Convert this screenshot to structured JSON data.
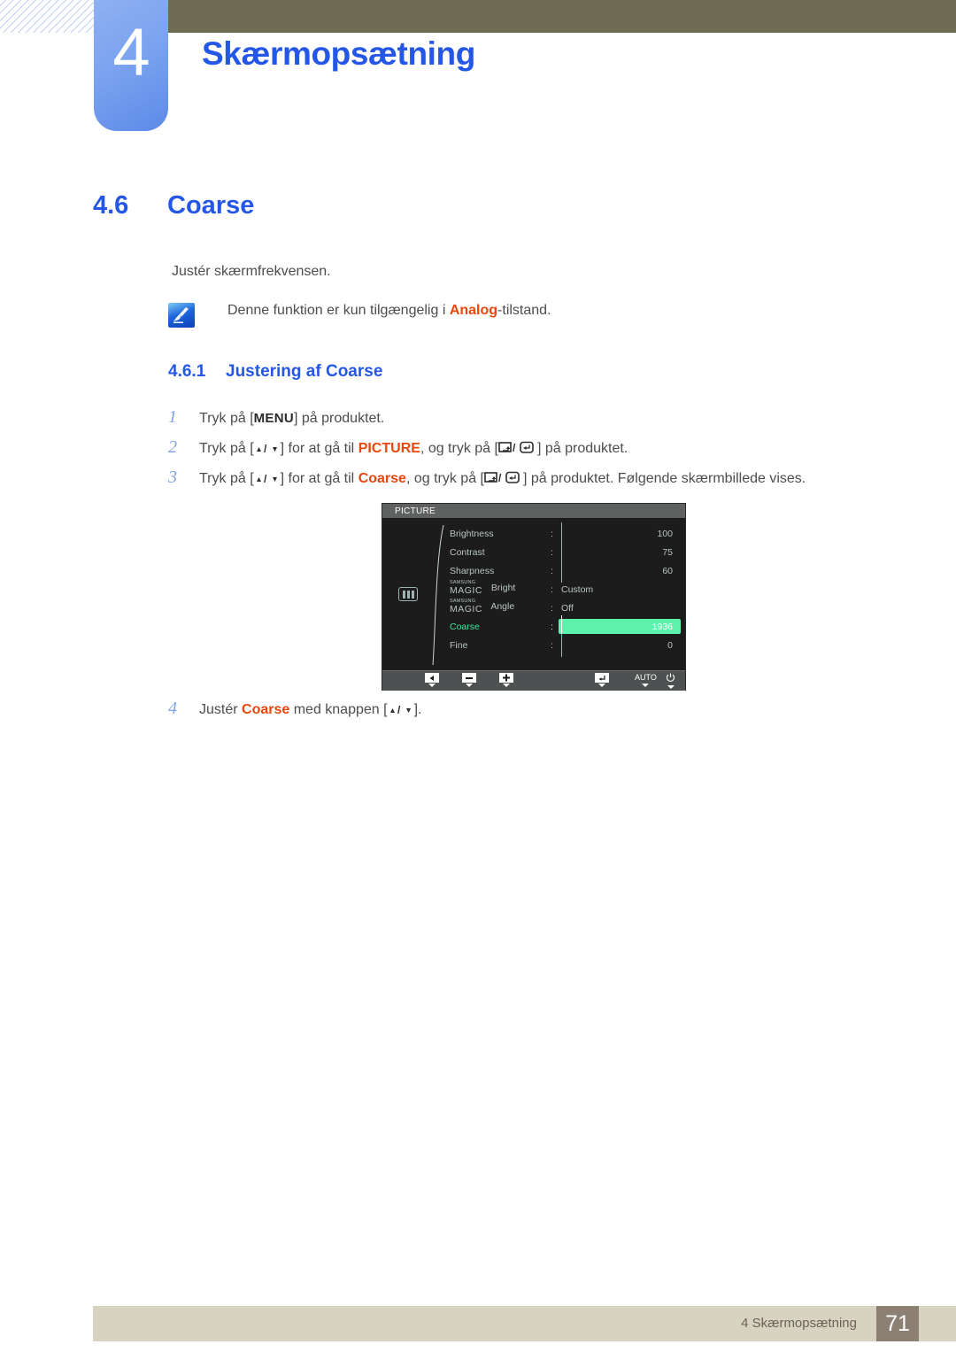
{
  "header": {
    "chapter_number": "4",
    "chapter_title": "Skærmopsætning"
  },
  "section": {
    "number": "4.6",
    "title": "Coarse",
    "intro": "Justér skærmfrekvensen."
  },
  "note": {
    "icon": "note-pencil-icon",
    "text_before": "Denne funktion er kun tilgængelig i ",
    "highlight": "Analog",
    "text_after": "-tilstand."
  },
  "subsection": {
    "number": "4.6.1",
    "title": "Justering af Coarse"
  },
  "steps": [
    {
      "number": "1",
      "parts": [
        {
          "t": "text",
          "v": "Tryk på ["
        },
        {
          "t": "key",
          "v": "MENU"
        },
        {
          "t": "text",
          "v": "] på produktet."
        }
      ]
    },
    {
      "number": "2",
      "parts": [
        {
          "t": "text",
          "v": "Tryk på ["
        },
        {
          "t": "updown",
          "v": "▲/▼"
        },
        {
          "t": "text",
          "v": "] for at gå til "
        },
        {
          "t": "orange",
          "v": "PICTURE"
        },
        {
          "t": "text",
          "v": ", og tryk på ["
        },
        {
          "t": "enterkeys",
          "v": "▭/↵"
        },
        {
          "t": "text",
          "v": "] på produktet."
        }
      ]
    },
    {
      "number": "3",
      "parts": [
        {
          "t": "text",
          "v": "Tryk på ["
        },
        {
          "t": "updown",
          "v": "▲/▼"
        },
        {
          "t": "text",
          "v": "] for at gå til "
        },
        {
          "t": "orange",
          "v": "Coarse"
        },
        {
          "t": "text",
          "v": ", og tryk på ["
        },
        {
          "t": "enterkeys",
          "v": "▭/↵"
        },
        {
          "t": "text",
          "v": "] på produktet. Følgende skærmbillede vises."
        }
      ]
    },
    {
      "number": "4",
      "parts": [
        {
          "t": "text",
          "v": "Justér "
        },
        {
          "t": "orange",
          "v": "Coarse"
        },
        {
          "t": "text",
          "v": " med knappen ["
        },
        {
          "t": "updown",
          "v": "▲/▼"
        },
        {
          "t": "text",
          "v": "]."
        }
      ]
    }
  ],
  "osd": {
    "title": "PICTURE",
    "panel_icon": "picture-panel-icon",
    "rows": [
      {
        "label": "Brightness",
        "type": "bar",
        "fill": 100,
        "value": "100",
        "selected": false
      },
      {
        "label": "Contrast",
        "type": "bar",
        "fill": 75,
        "value": "75",
        "selected": false
      },
      {
        "label": "Sharpness",
        "type": "bar",
        "fill": 60,
        "value": "60",
        "selected": false
      },
      {
        "label": "Bright",
        "brand_top": "SAMSUNG",
        "brand_main": "MAGIC",
        "type": "text",
        "value": "Custom",
        "selected": false
      },
      {
        "label": "Angle",
        "brand_top": "SAMSUNG",
        "brand_main": "MAGIC",
        "type": "text",
        "value": "Off",
        "selected": false
      },
      {
        "label": "Coarse",
        "type": "bar",
        "fill": 50,
        "value": "1936",
        "selected": true
      },
      {
        "label": "Fine",
        "type": "bar",
        "fill": 0,
        "value": "0",
        "selected": false
      }
    ],
    "footer_buttons": [
      {
        "name": "back-button",
        "glyph": "◀"
      },
      {
        "name": "minus-button",
        "glyph": "—"
      },
      {
        "name": "plus-button",
        "glyph": "+"
      },
      {
        "name": "enter-button",
        "glyph": "↵"
      },
      {
        "name": "auto-button",
        "glyph": "AUTO"
      },
      {
        "name": "power-button",
        "glyph": "⏻"
      }
    ]
  },
  "footer": {
    "text": "4 Skærmopsætning",
    "page": "71"
  },
  "colors": {
    "accent_blue": "#2457e8",
    "orange": "#e8470e",
    "olive": "#6e6c53",
    "osd_green": "#5df2ab",
    "footer_tan": "#d8d2c0"
  }
}
